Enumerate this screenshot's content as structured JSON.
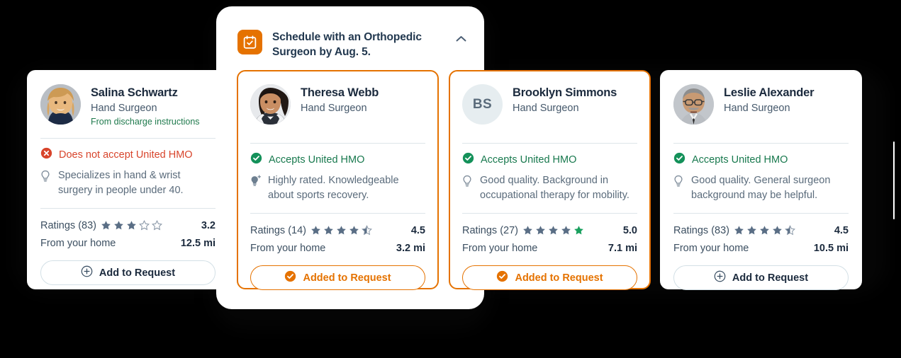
{
  "panel": {
    "icon": "calendar-check-icon",
    "title": "Schedule with an Orthopedic Surgeon by Aug. 5.",
    "collapse_icon": "chevron-up-icon",
    "accent_color": "#E57200",
    "title_color": "#22384F"
  },
  "colors": {
    "accent": "#E57200",
    "success": "#18794E",
    "danger": "#D8442B",
    "text": "#1B2A3D",
    "muted": "#5A6B7B",
    "divider": "#DDE5E9"
  },
  "labels": {
    "ratings_prefix": "Ratings",
    "distance_label": "From your home",
    "add_button": "Add to Request",
    "added_button": "Added to Request",
    "add_icon": "plus-circle-icon",
    "added_icon": "check-circle-icon",
    "insight_icon": "lightbulb-icon",
    "insight_ai_icon": "lightbulb-sparkle-icon",
    "accepts_icon": "check-circle-icon",
    "rejects_icon": "x-circle-icon"
  },
  "cards": [
    {
      "id": "salina-schwartz",
      "name": "Salina Schwartz",
      "role": "Hand Surgeon",
      "source": "From discharge instructions",
      "avatar_type": "photo",
      "avatar_variant": "woman-blonde",
      "initials": "",
      "insurance_text": "Does not accept United HMO",
      "insurance_accepted": false,
      "note": "Specializes in hand & wrist surgery in people under 40.",
      "note_ai": false,
      "ratings_label": "Ratings (83)",
      "ratings_count": 83,
      "rating": 3.2,
      "rating_text": "3.2",
      "stars_full": 3,
      "stars_half": 0,
      "star_highlight": false,
      "distance_label": "From your home",
      "distance": "12.5 mi",
      "selected": false,
      "button_label": "Add to Request",
      "button_state": "add"
    },
    {
      "id": "theresa-webb",
      "name": "Theresa Webb",
      "role": "Hand Surgeon",
      "source": "",
      "avatar_type": "photo",
      "avatar_variant": "woman-dark-hair",
      "initials": "",
      "insurance_text": "Accepts United HMO",
      "insurance_accepted": true,
      "note": "Highly rated. Knowledgeable about sports recovery.",
      "note_ai": true,
      "ratings_label": "Ratings (14)",
      "ratings_count": 14,
      "rating": 4.5,
      "rating_text": "4.5",
      "stars_full": 4,
      "stars_half": 1,
      "star_highlight": false,
      "distance_label": "From your home",
      "distance": "3.2 mi",
      "selected": true,
      "button_label": "Added to Request",
      "button_state": "added"
    },
    {
      "id": "brooklyn-simmons",
      "name": "Brooklyn Simmons",
      "role": "Hand Surgeon",
      "source": "",
      "avatar_type": "initials",
      "avatar_variant": "",
      "initials": "BS",
      "insurance_text": "Accepts United HMO",
      "insurance_accepted": true,
      "note": "Good quality. Background in occupational therapy for mobility.",
      "note_ai": false,
      "ratings_label": "Ratings (27)",
      "ratings_count": 27,
      "rating": 5.0,
      "rating_text": "5.0",
      "stars_full": 5,
      "stars_half": 0,
      "star_highlight": true,
      "distance_label": "From your home",
      "distance": "7.1 mi",
      "selected": true,
      "button_label": "Added to Request",
      "button_state": "added"
    },
    {
      "id": "leslie-alexander",
      "name": "Leslie Alexander",
      "role": "Hand Surgeon",
      "source": "",
      "avatar_type": "photo",
      "avatar_variant": "man-glasses",
      "initials": "",
      "insurance_text": "Accepts United HMO",
      "insurance_accepted": true,
      "note": "Good quality. General surgeon background may be helpful.",
      "note_ai": false,
      "ratings_label": "Ratings (83)",
      "ratings_count": 83,
      "rating": 4.5,
      "rating_text": "4.5",
      "stars_full": 4,
      "stars_half": 1,
      "star_highlight": false,
      "distance_label": "From your home",
      "distance": "10.5 mi",
      "selected": false,
      "button_label": "Add to Request",
      "button_state": "add"
    }
  ]
}
